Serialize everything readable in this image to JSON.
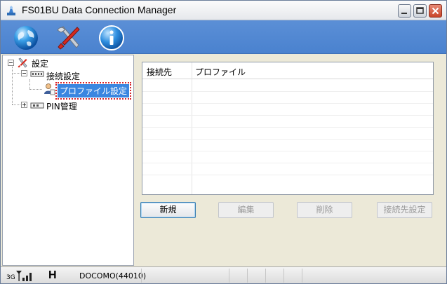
{
  "window": {
    "title": "FS01BU Data Connection Manager"
  },
  "toolbar": {
    "buttons": [
      {
        "icon": "globe-icon"
      },
      {
        "icon": "tools-icon"
      },
      {
        "icon": "info-icon"
      }
    ]
  },
  "tree": {
    "root": {
      "label": "設定",
      "icon": "tools-icon"
    },
    "children": [
      {
        "label": "接続設定",
        "icon": "network-icon",
        "children": [
          {
            "label": "プロファイル設定",
            "icon": "user-profile-icon",
            "selected": true
          }
        ]
      },
      {
        "label": "PIN管理",
        "icon": "sim-icon"
      }
    ]
  },
  "profile_list": {
    "columns": [
      "接続先",
      "プロファイル"
    ],
    "rows": []
  },
  "actions": {
    "new_label": "新規",
    "edit_label": "編集",
    "delete_label": "削除",
    "set_destination_label": "接続先設定"
  },
  "status": {
    "network_type": "3G",
    "mode": "H",
    "carrier": "DOCOMO(44010)"
  },
  "colors": {
    "toolbar": "#4a82cf",
    "selection": "#3a86e0"
  }
}
